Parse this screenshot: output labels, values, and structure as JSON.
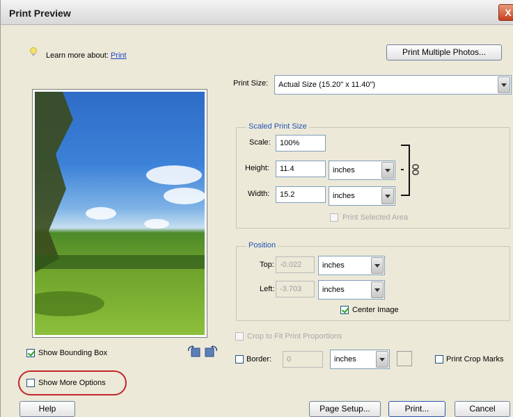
{
  "window": {
    "title": "Print Preview",
    "close_label": "X"
  },
  "learn_more": {
    "prefix": "Learn more about:",
    "link": "Print"
  },
  "buttons": {
    "print_multiple": "Print Multiple Photos...",
    "help": "Help",
    "page_setup": "Page Setup...",
    "print": "Print...",
    "cancel": "Cancel"
  },
  "print_size": {
    "label": "Print Size:",
    "value": "Actual Size (15.20\" x 11.40\")"
  },
  "scaled": {
    "legend": "Scaled Print Size",
    "scale_label": "Scale:",
    "scale_value": "100%",
    "height_label": "Height:",
    "height_value": "11.4",
    "height_unit": "inches",
    "width_label": "Width:",
    "width_value": "15.2",
    "width_unit": "inches",
    "print_selected_area": "Print Selected Area"
  },
  "position": {
    "legend": "Position",
    "top_label": "Top:",
    "top_value": "-0.022",
    "top_unit": "inches",
    "left_label": "Left:",
    "left_value": "-3.703",
    "left_unit": "inches",
    "center_image": "Center Image"
  },
  "crop_to_fit": "Crop to Fit Print Proportions",
  "border": {
    "label": "Border:",
    "value": "0",
    "unit": "inches"
  },
  "print_crop_marks": "Print Crop Marks",
  "show_bounding_box": "Show Bounding Box",
  "show_more_options": "Show More Options",
  "colors": {
    "legend_blue": "#2253b3",
    "highlight_circle": "#c0262a"
  }
}
